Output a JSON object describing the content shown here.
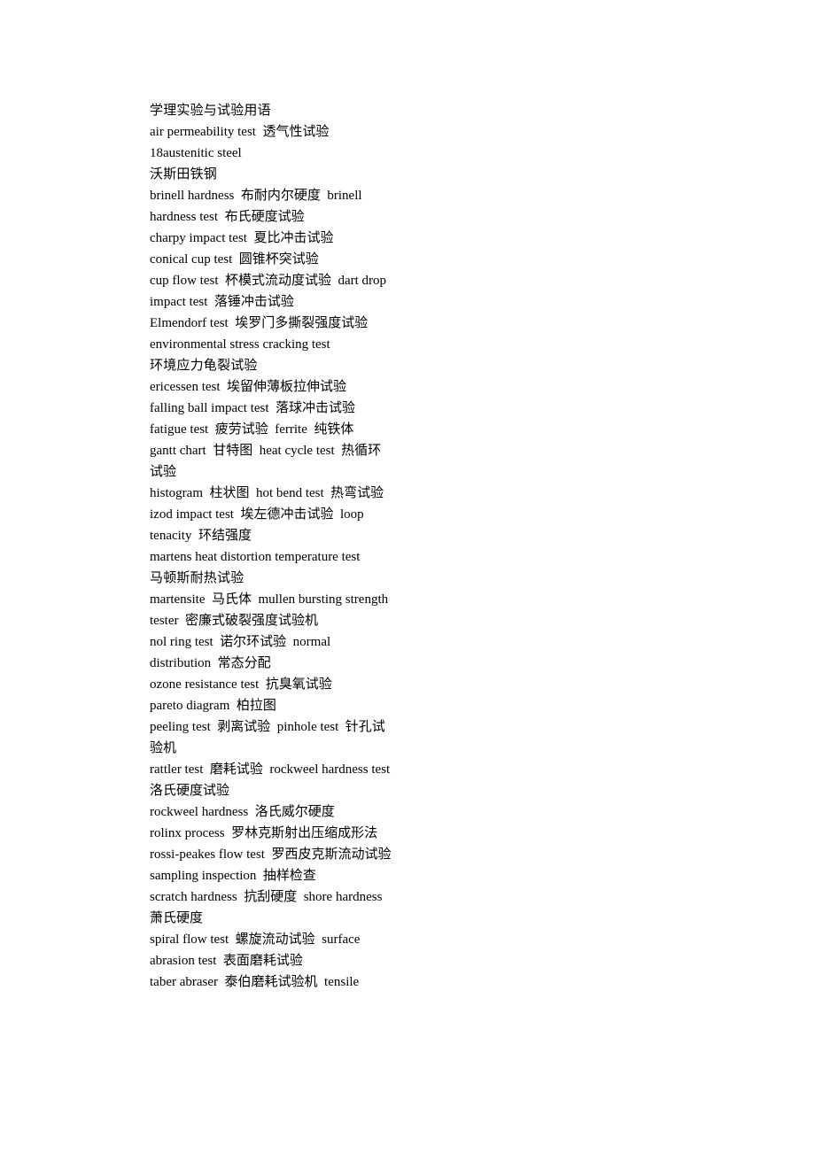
{
  "document": {
    "title": "学理实验与试验用语",
    "background_color": "#ffffff",
    "text_color": "#000000",
    "lines": [
      "学理实验与试验用语",
      "air permeability test  透气性试验",
      "18austenitic steel",
      "沃斯田铁钢",
      "brinell hardness  布耐内尔硬度  brinell hardness test  布氏硬度试验",
      "charpy impact test  夏比冲击试验",
      "conical cup test  圆锥杯突试验",
      "cup flow test  杯模式流动度试验  dart drop impact test  落锤冲击试验",
      "Elmendorf test  埃罗门多撕裂强度试验",
      "environmental stress cracking test",
      "环境应力龟裂试验",
      "ericessen test  埃留伸薄板拉伸试验",
      "falling ball impact test  落球冲击试验",
      "fatigue test  疲劳试验  ferrite  纯铁体",
      "gantt chart  甘特图  heat cycle test  热循环试验",
      "histogram  柱状图  hot bend test  热弯试验",
      "izod impact test  埃左德冲击试验  loop tenacity  环结强度",
      "martens heat distortion temperature test",
      "马顿斯耐热试验",
      "martensite  马氏体  mullen bursting strength tester  密廉式破裂强度试验机",
      "nol ring test  诺尔环试验  normal distribution  常态分配",
      "ozone resistance test  抗臭氧试验",
      "pareto diagram  柏拉图",
      "peeling test  剥离试验  pinhole test  针孔试验机",
      "rattler test  磨耗试验  rockweel hardness test  洛氏硬度试验",
      "rockweel hardness  洛氏威尔硬度",
      "rolinx process  罗林克斯射出压缩成形法",
      "rossi-peakes flow test  罗西皮克斯流动试验  sampling inspection  抽样检查",
      "scratch hardness  抗刮硬度  shore hardness  萧氏硬度",
      "spiral flow test  螺旋流动试验  surface abrasion test  表面磨耗试验",
      "taber abraser  泰伯磨耗试验机  tensile"
    ]
  }
}
